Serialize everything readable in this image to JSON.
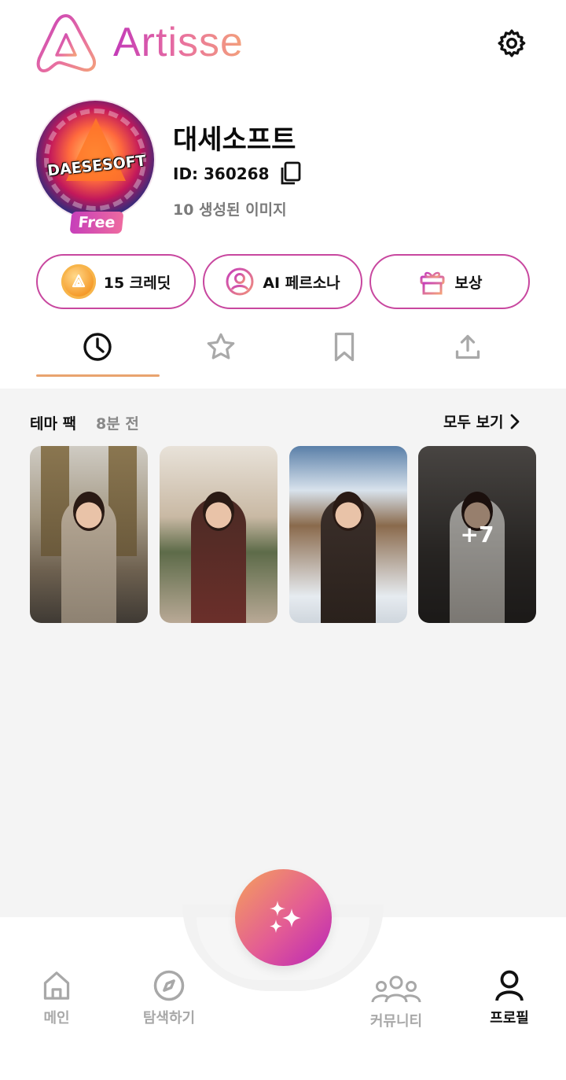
{
  "header": {
    "app_name": "Artisse"
  },
  "profile": {
    "avatar_text": "DAESESOFT",
    "plan_badge": "Free",
    "name": "대세소프트",
    "id_text": "ID: 360268",
    "generated_text": "10 생성된 이미지"
  },
  "actions": [
    {
      "label": "15 크레딧",
      "icon": "coin-icon"
    },
    {
      "label": "AI 페르소나",
      "icon": "persona-icon"
    },
    {
      "label": "보상",
      "icon": "gift-icon"
    }
  ],
  "tabs": [
    {
      "icon": "clock-icon",
      "active": true
    },
    {
      "icon": "star-icon",
      "active": false
    },
    {
      "icon": "bookmark-icon",
      "active": false
    },
    {
      "icon": "upload-icon",
      "active": false
    }
  ],
  "section": {
    "title": "테마 팩",
    "time": "8분 전",
    "see_all": "모두 보기",
    "more_count": "+7"
  },
  "bottom_nav": {
    "items": [
      {
        "label": "메인",
        "icon": "home-icon"
      },
      {
        "label": "탐색하기",
        "icon": "compass-icon"
      },
      {
        "label": "커뮤니티",
        "icon": "community-icon"
      },
      {
        "label": "프로필",
        "icon": "profile-icon",
        "active": true
      }
    ],
    "center_button_icon": "sparkle-icon"
  },
  "colors": {
    "accent_pink": "#c8479f",
    "accent_orange": "#e9a36f",
    "muted_text": "#7a7a7a",
    "background_gray": "#f4f4f4"
  }
}
